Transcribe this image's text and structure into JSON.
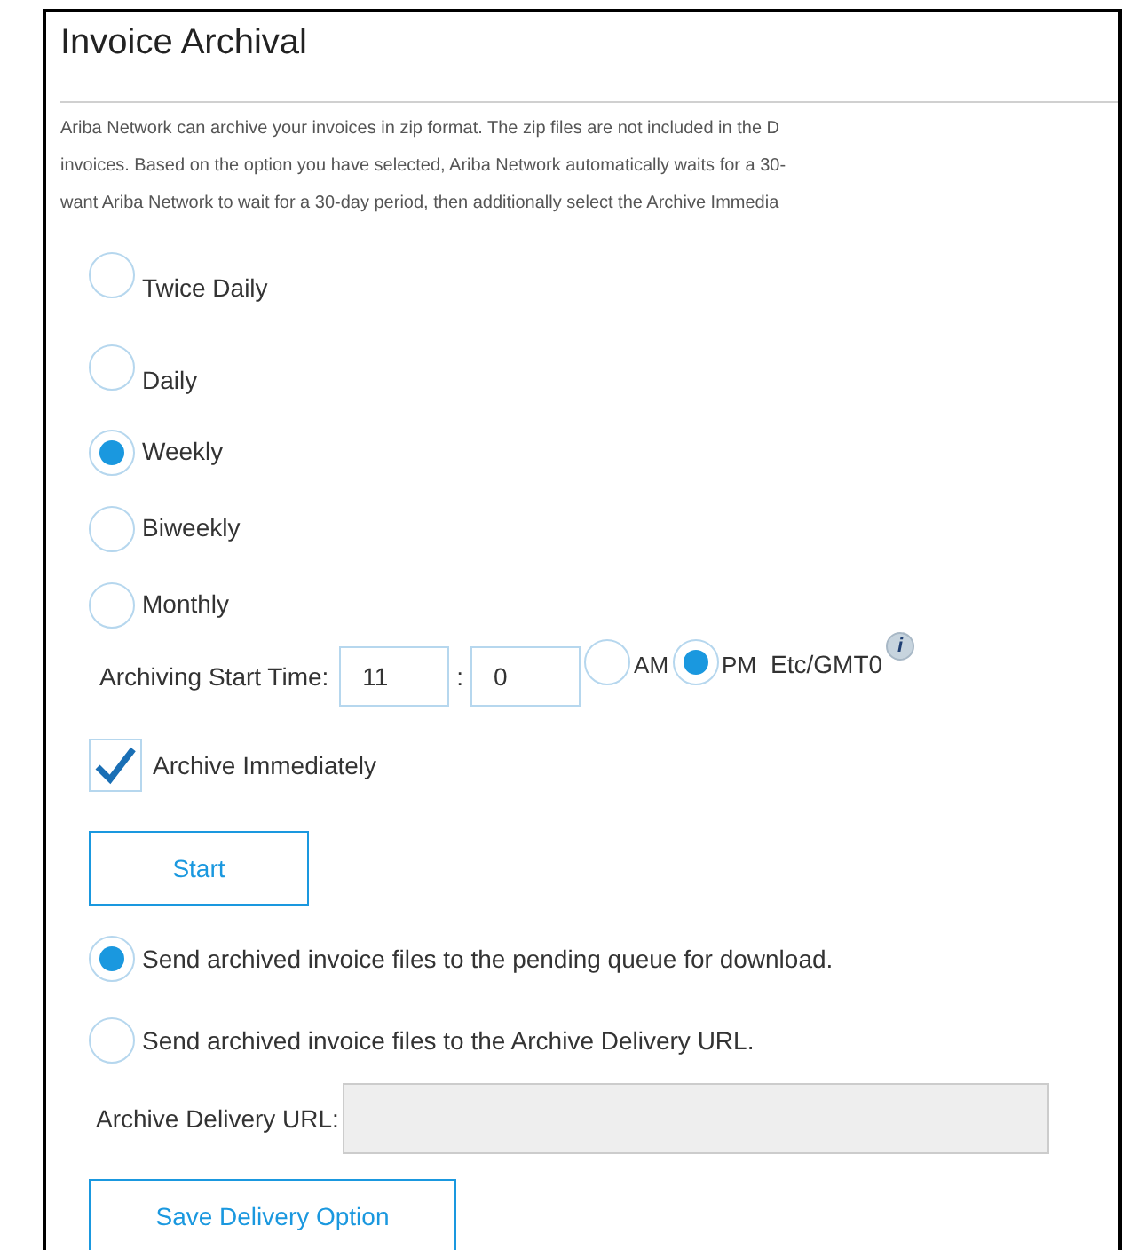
{
  "title": "Invoice Archival",
  "description_lines": [
    "Ariba Network can archive your invoices in zip format. The zip files are not included in the D",
    "invoices. Based on the option you have selected, Ariba Network automatically waits for a 30-",
    "want Ariba Network to wait for a 30-day period, then additionally select the Archive Immedia"
  ],
  "frequency_options": [
    {
      "label": "Twice Daily",
      "selected": false
    },
    {
      "label": "Daily",
      "selected": false
    },
    {
      "label": "Weekly",
      "selected": true
    },
    {
      "label": "Biweekly",
      "selected": false
    },
    {
      "label": "Monthly",
      "selected": false
    }
  ],
  "start_time": {
    "label": "Archiving Start Time:",
    "hour": "11",
    "separator": ":",
    "minute": "0",
    "periods": [
      {
        "label": "AM",
        "selected": false
      },
      {
        "label": "PM",
        "selected": true
      }
    ],
    "timezone": "Etc/GMT0",
    "info_icon": "i"
  },
  "archive_immediately": {
    "label": "Archive Immediately",
    "checked": true
  },
  "start_button": "Start",
  "delivery_options": [
    {
      "label": "Send archived invoice files to the pending queue for download.",
      "selected": true
    },
    {
      "label": "Send archived invoice files to the Archive Delivery URL.",
      "selected": false
    }
  ],
  "delivery_url": {
    "label": "Archive Delivery URL:",
    "disabled": true
  },
  "save_button": "Save Delivery Option"
}
